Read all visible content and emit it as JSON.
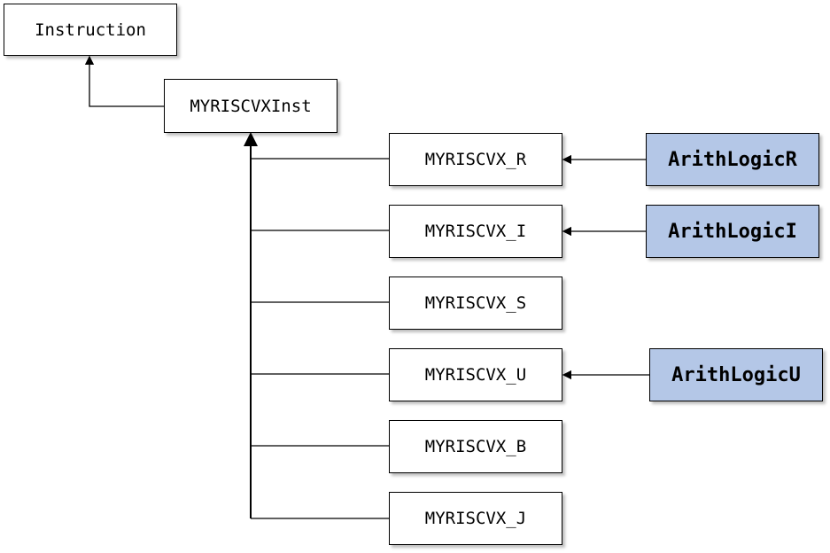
{
  "nodes": {
    "instruction": "Instruction",
    "myriscvx_inst": "MYRISCVXInst",
    "r": "MYRISCVX_R",
    "i": "MYRISCVX_I",
    "s": "MYRISCVX_S",
    "u": "MYRISCVX_U",
    "b": "MYRISCVX_B",
    "j": "MYRISCVX_J",
    "arith_r": "ArithLogicR",
    "arith_i": "ArithLogicI",
    "arith_u": "ArithLogicU"
  },
  "colors": {
    "highlight": "#b4c7e7"
  }
}
